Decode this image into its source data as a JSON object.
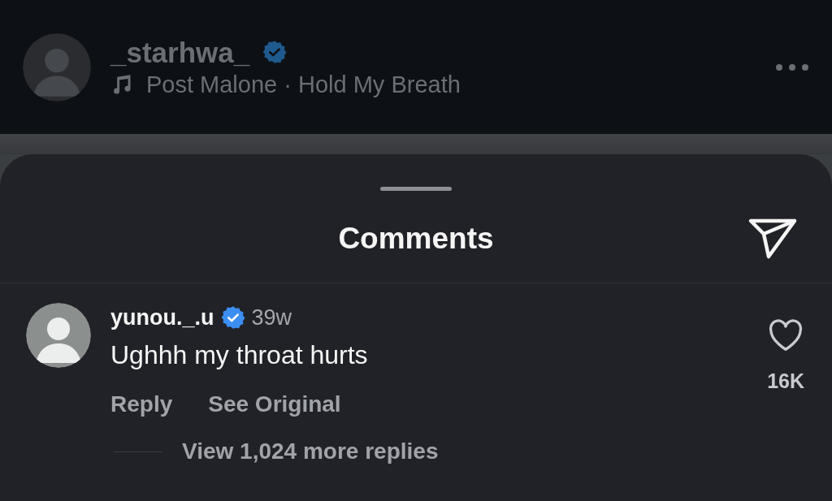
{
  "post_header": {
    "username": "_starhwa_",
    "verified": true,
    "music": "Post Malone · Hold My Breath"
  },
  "sheet": {
    "title": "Comments"
  },
  "comments": [
    {
      "username": "yunou._.u",
      "verified": true,
      "time": "39w",
      "text": "Ughhh my throat hurts",
      "actions": [
        "Reply",
        "See Original"
      ],
      "liked": false,
      "like_count": "16K",
      "view_replies": "View 1,024 more replies"
    }
  ]
}
